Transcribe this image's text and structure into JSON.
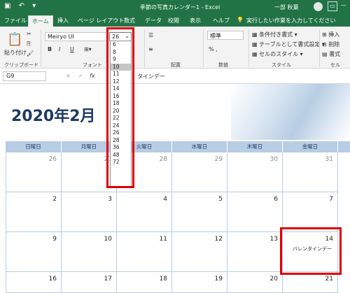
{
  "title_bar": {
    "quick_access": "↶ ▾",
    "title": "季節の写真カレンダー1 - Excel",
    "user": "一部 秋葉",
    "min": "—",
    "max": "□",
    "close": "×"
  },
  "tabs": [
    "ファイル",
    "ホーム",
    "挿入",
    "ページ レイアウト",
    "数式",
    "データ",
    "校閲",
    "表示",
    "ヘルプ",
    "実行したい作業を入力してください"
  ],
  "ribbon": {
    "clipboard": {
      "paste": "貼り付け",
      "label": "クリップボード"
    },
    "font": {
      "name": "Meiryo UI",
      "size": "26",
      "bold": "B",
      "italic": "I",
      "underline": "U",
      "label": "フォント"
    },
    "alignment": {
      "label": "配置"
    },
    "number": {
      "format": "標準",
      "label": "数値"
    },
    "styles": {
      "conditional": "条件付き書式",
      "table": "テーブルとして書式設定",
      "cell": "セルのスタイル",
      "label": "スタイル"
    },
    "cells": {
      "insert": "挿入",
      "delete": "削除",
      "format": "書式",
      "label": "セル"
    }
  },
  "formula_bar": {
    "name_box": "G9",
    "cancel": "×",
    "enter": "✓",
    "fx": "fx",
    "content": "タインデー"
  },
  "font_sizes": [
    "6",
    "8",
    "9",
    "10",
    "11",
    "12",
    "14",
    "16",
    "18",
    "20",
    "22",
    "24",
    "26",
    "28",
    "36",
    "48",
    "72"
  ],
  "selected_size": "10",
  "calendar": {
    "title": "2020年2月",
    "weekdays": [
      "日曜日",
      "月曜日",
      "火曜日",
      "水曜日",
      "木曜日",
      "金曜日"
    ],
    "weeks": [
      [
        "26",
        "27",
        "28",
        "29",
        "30",
        "31"
      ],
      [
        "2",
        "3",
        "4",
        "5",
        "6",
        "7"
      ],
      [
        "9",
        "10",
        "11",
        "12",
        "13",
        "14"
      ],
      [
        "16",
        "17",
        "18",
        "19",
        "20",
        "21"
      ]
    ],
    "note": "バレンタインデー"
  },
  "colors": {
    "excel_green": "#217346",
    "header_blue": "#b8cce4",
    "title_navy": "#1f3a64",
    "highlight": "#e00000"
  }
}
